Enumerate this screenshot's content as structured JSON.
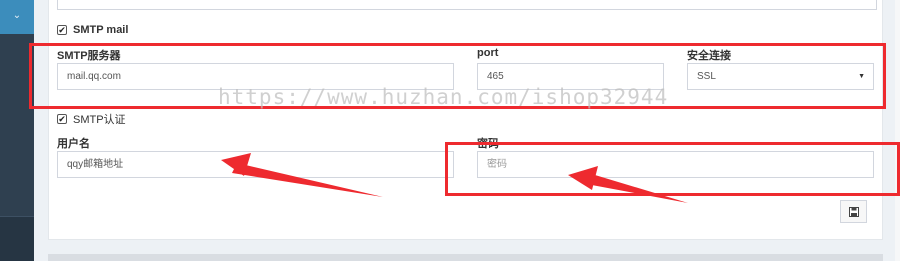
{
  "sidebar": {
    "toggle_icon": "chevron-down-icon"
  },
  "form": {
    "smtp_mail": {
      "label": "SMTP mail",
      "checked": true
    },
    "server": {
      "label": "SMTP服务器",
      "value": "mail.qq.com"
    },
    "port": {
      "label": "port",
      "value": "465"
    },
    "security": {
      "label": "安全连接",
      "value": "SSL"
    },
    "smtp_auth": {
      "label": "SMTP认证",
      "checked": true
    },
    "username": {
      "label": "用户名",
      "value": "qqy邮箱地址"
    },
    "password": {
      "label": "密码",
      "placeholder": "密码"
    },
    "save_icon": "floppy-disk-icon"
  },
  "overlay": {
    "watermark": "https://www.huzhan.com/ishop32944",
    "highlight_color": "#ee2a2f"
  }
}
